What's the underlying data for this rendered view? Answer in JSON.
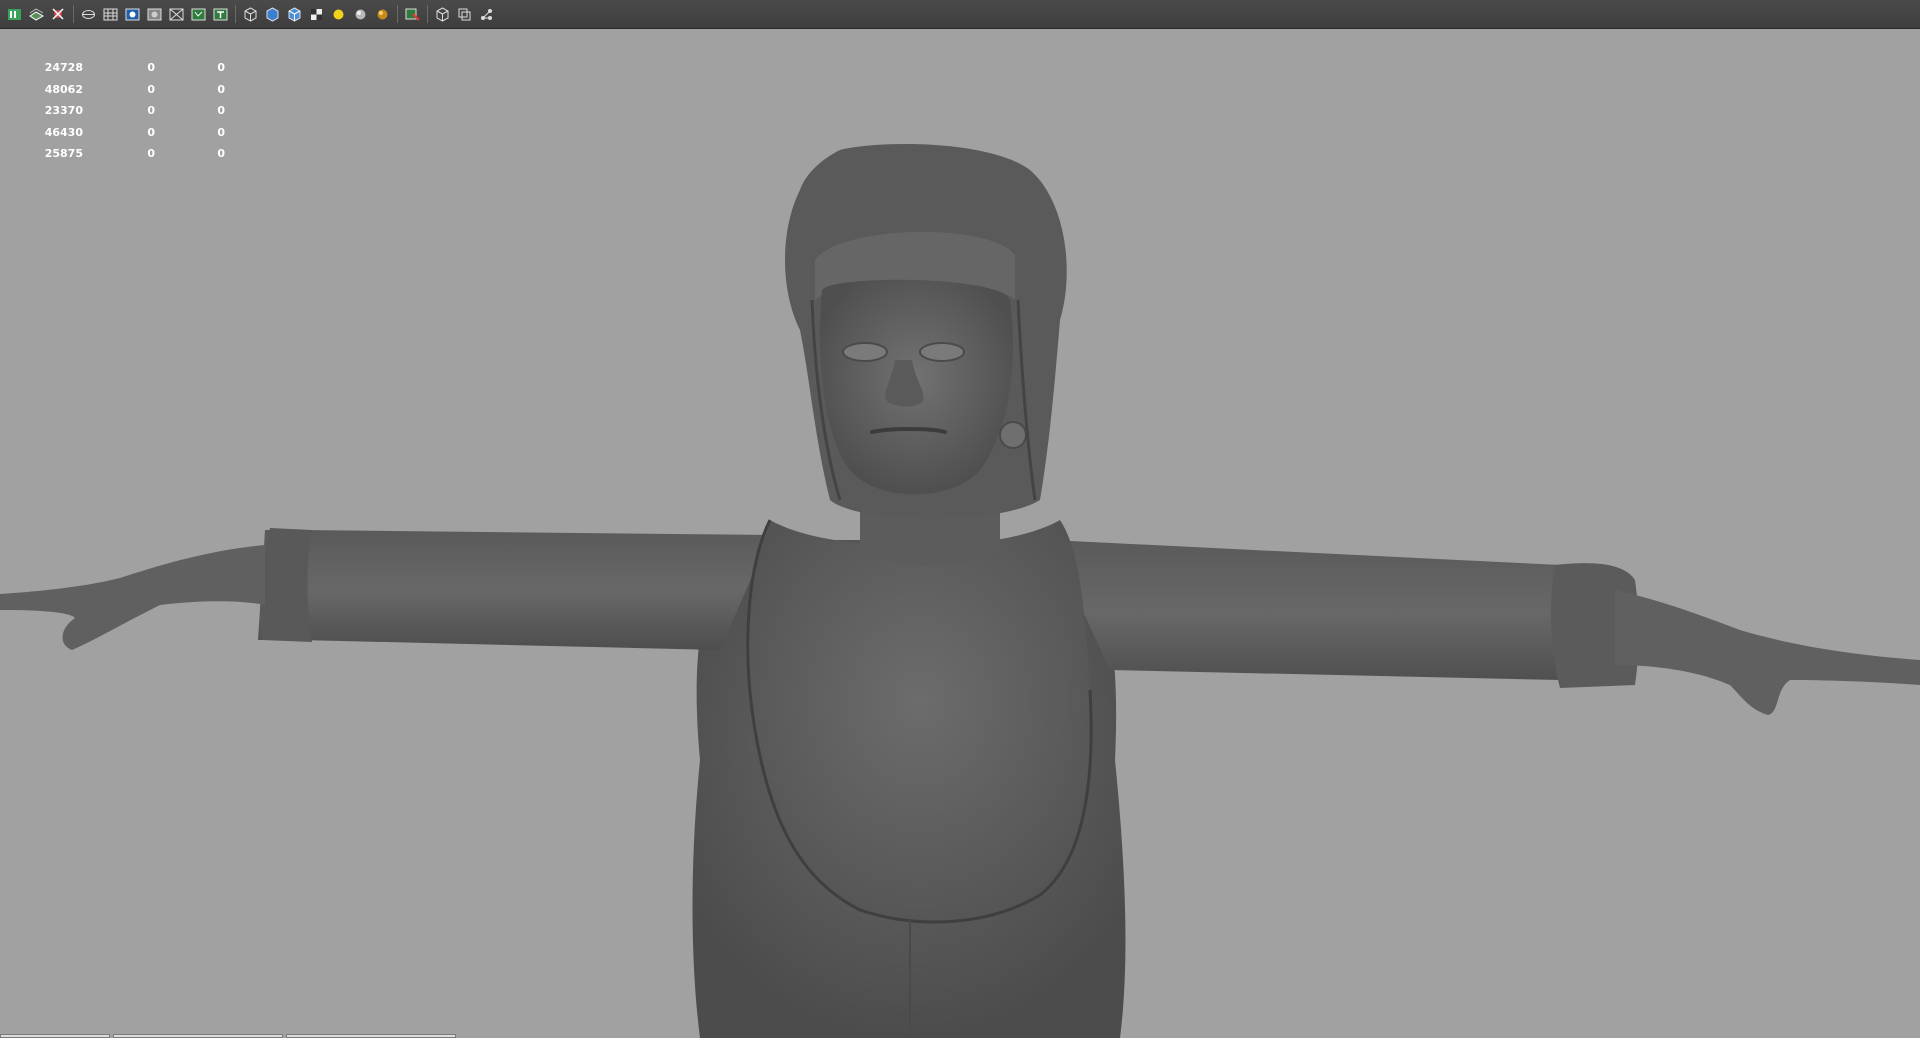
{
  "toolbar": {
    "groups": [
      [
        "channel-box-icon",
        "layer-editor-icon",
        "dependency-icon"
      ],
      [
        "wireframe-icon",
        "grid-icon",
        "film-gate-icon",
        "resolution-gate-icon",
        "gate-mask-icon",
        "field-chart-icon",
        "safe-title-icon"
      ],
      [
        "wireframe-shading-icon",
        "smooth-shade-all-icon",
        "wireframe-on-shaded-icon",
        "textured-icon",
        "use-all-lights-icon",
        "shadows-icon",
        "ambient-occlusion-icon"
      ],
      [
        "isolate-select-icon"
      ],
      [
        "xray-icon",
        "xray-joints-icon",
        "xray-active-components-icon"
      ]
    ]
  },
  "hud": {
    "rows": [
      [
        "24728",
        "0",
        "0"
      ],
      [
        "48062",
        "0",
        "0"
      ],
      [
        "23370",
        "0",
        "0"
      ],
      [
        "46430",
        "0",
        "0"
      ],
      [
        "25875",
        "0",
        "0"
      ]
    ]
  },
  "bottom_tabs": [
    "",
    "",
    ""
  ],
  "colors": {
    "viewport_bg": "#a1a1a1",
    "toolbar_bg": "#444444",
    "model_shade": "#5f5f5f",
    "hud_text": "#ffffff"
  }
}
